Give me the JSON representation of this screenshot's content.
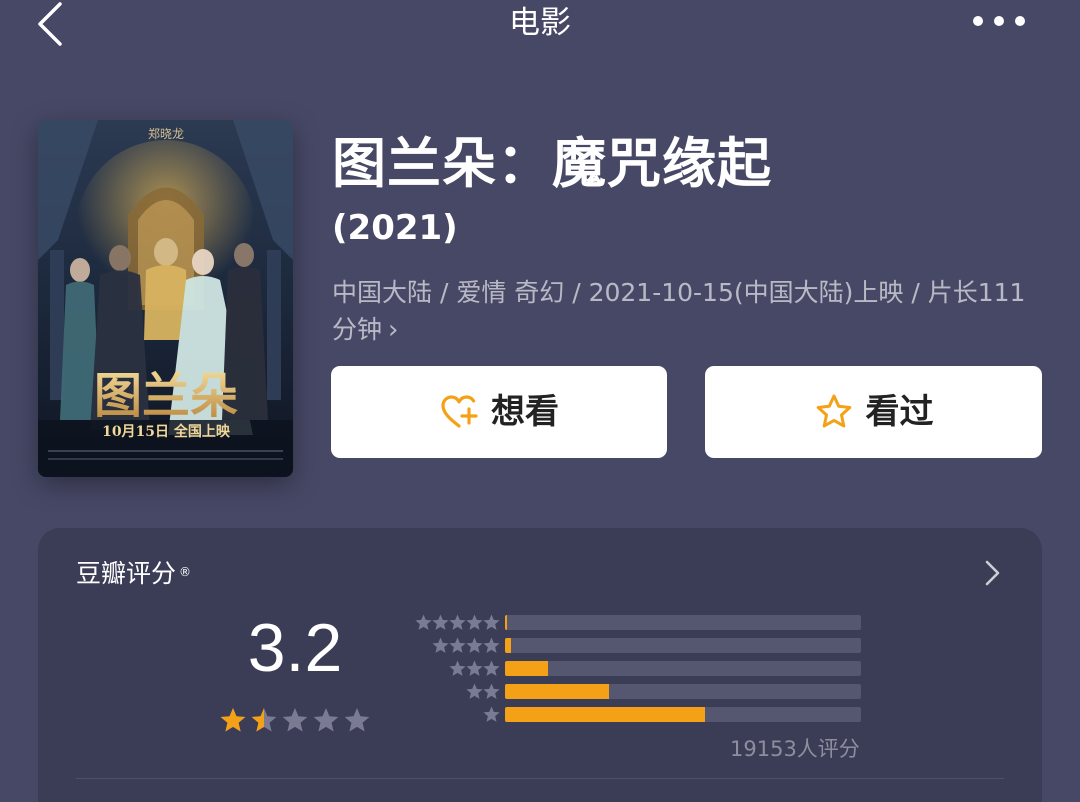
{
  "nav": {
    "title": "电影",
    "back_icon": "chevron-left-icon",
    "more_icon": "more-horizontal-icon"
  },
  "movie": {
    "title": "图兰朵：魔咒缘起",
    "year": "(2021)",
    "meta": "中国大陆 / 爱情 奇幻 / 2021-10-15(中国大陆)上映 / 片长111分钟",
    "poster": {
      "title_art": "图兰朵",
      "release_text": "10月15日 全国上映",
      "top_text": "郑晓龙"
    }
  },
  "actions": {
    "want_label": "想看",
    "want_icon": "heart-plus-icon",
    "seen_label": "看过",
    "seen_icon": "star-outline-icon"
  },
  "rating": {
    "title": "豆瓣评分",
    "trademark": "®",
    "score": "3.2",
    "stars": 1.5,
    "count_text": "19153人评分",
    "distribution": [
      {
        "stars": 5,
        "fraction": 0.005
      },
      {
        "stars": 4,
        "fraction": 0.016
      },
      {
        "stars": 3,
        "fraction": 0.12
      },
      {
        "stars": 2,
        "fraction": 0.292
      },
      {
        "stars": 1,
        "fraction": 0.561
      }
    ]
  },
  "colors": {
    "background": "#474866",
    "card": "#3b3c56",
    "accent": "#f5a117",
    "star_empty": "#7a7b92"
  }
}
